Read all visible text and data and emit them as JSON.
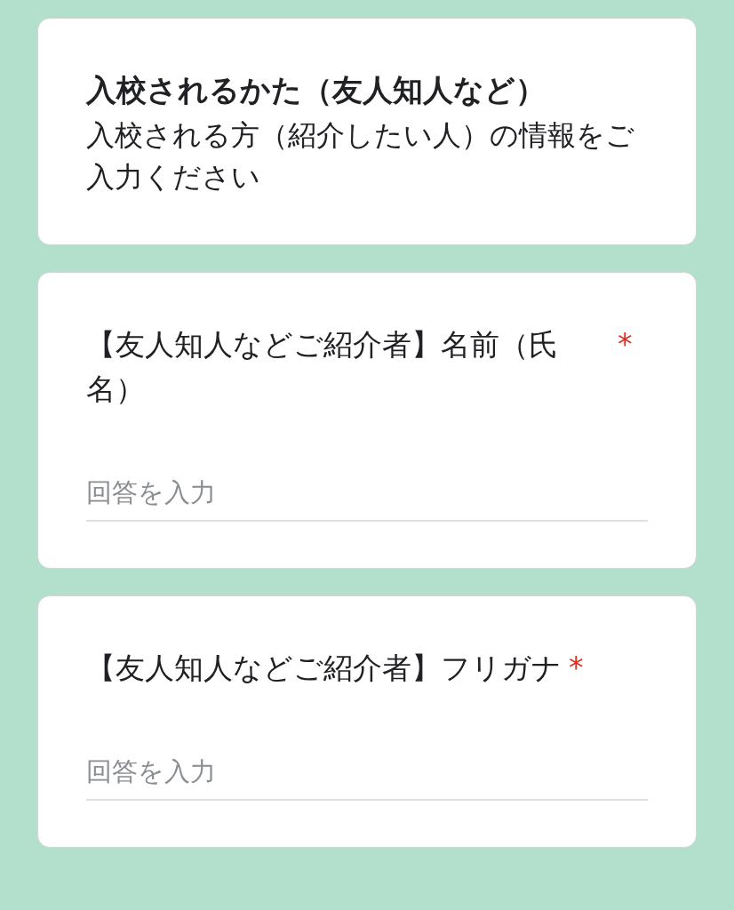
{
  "header": {
    "title": "入校されるかた（友人知人など）",
    "description": "入校される方（紹介したい人）の情報をご入力ください"
  },
  "questions": [
    {
      "label": "【友人知人などご紹介者】名前（氏名）",
      "required_mark": "*",
      "placeholder": "回答を入力"
    },
    {
      "label": "【友人知人などご紹介者】フリガナ",
      "required_mark": "*",
      "placeholder": "回答を入力"
    }
  ]
}
